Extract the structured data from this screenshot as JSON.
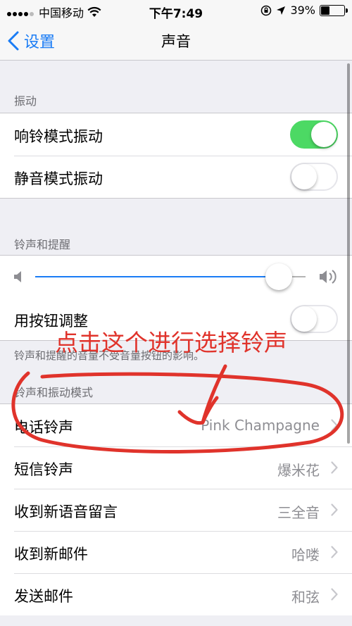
{
  "status_bar": {
    "carrier": "中国移动",
    "time": "下午7:49",
    "battery": "39%",
    "battery_level": 0.39
  },
  "nav": {
    "back_label": "设置",
    "title": "声音"
  },
  "vibrate": {
    "header": "振动",
    "rows": [
      {
        "label": "响铃模式振动",
        "on": true
      },
      {
        "label": "静音模式振动",
        "on": false
      }
    ]
  },
  "ringer": {
    "header": "铃声和提醒",
    "volume": 0.9,
    "buttons_label": "用按钮调整",
    "buttons_on": false,
    "footnote": "铃声和提醒的音量不受音量按钮的影响。"
  },
  "patterns": {
    "header": "铃声和振动模式",
    "rows": [
      {
        "label": "电话铃声",
        "value": "Pink Champagne"
      },
      {
        "label": "短信铃声",
        "value": "爆米花"
      },
      {
        "label": "收到新语音留言",
        "value": "三全音"
      },
      {
        "label": "收到新邮件",
        "value": "哈喽"
      },
      {
        "label": "发送邮件",
        "value": "和弦"
      }
    ]
  },
  "annotation": {
    "text": "点击这个进行选择铃声",
    "color": "#e0332b"
  },
  "colors": {
    "accent": "#1a7cf5",
    "toggle_on": "#4cd964"
  }
}
